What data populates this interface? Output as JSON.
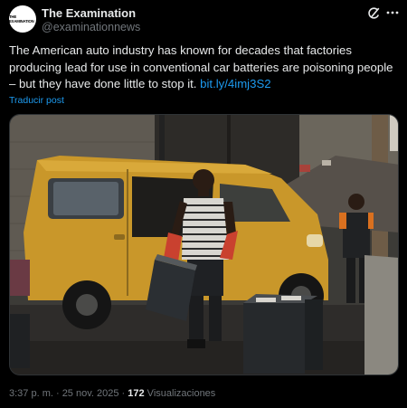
{
  "account": {
    "avatar_text": "THE EXAMINATION",
    "name": "The Examination",
    "handle": "@examinationnews"
  },
  "header_icons": [
    "grok-icon",
    "more-icon"
  ],
  "tweet": {
    "text": "The American auto industry has known for decades that factories producing lead for use in conventional car batteries are poisoning people – but they have done little to stop it.",
    "link": "bit.ly/4imj3S2",
    "translate_label": "Traducir post"
  },
  "footer": {
    "timestamp": "3:37 p. m. · 25 nov. 2025 · ",
    "views_count": "172",
    "views_label": " Visualizaciones"
  },
  "colors": {
    "background": "#000000",
    "text": "#e7e9ea",
    "muted": "#71767b",
    "link": "#1d9bf0"
  }
}
